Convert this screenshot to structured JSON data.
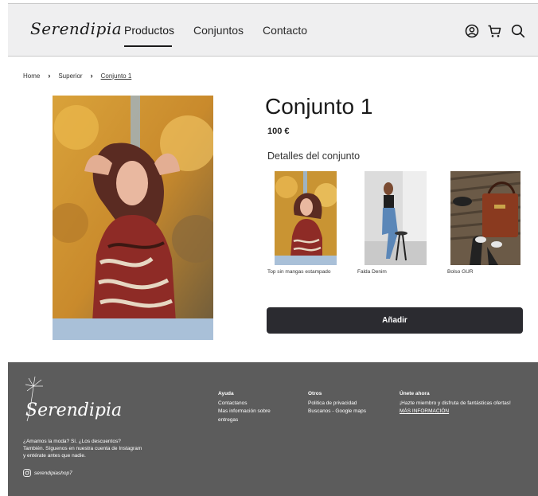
{
  "header": {
    "logo": "Serendipia",
    "nav": [
      "Productos",
      "Conjuntos",
      "Contacto"
    ],
    "icons": [
      "user-icon",
      "cart-icon",
      "search-icon"
    ]
  },
  "breadcrumb": [
    "Home",
    "Superior",
    "Conjunto 1"
  ],
  "product": {
    "title": "Conjunto 1",
    "price": "100 €",
    "details_heading": "Detalles del conjunto",
    "items": [
      "Top sin mangas estampado",
      "Falda Denim",
      "Bolso GUR"
    ],
    "add_button": "Añadir"
  },
  "footer": {
    "logo": "Serendipia",
    "text": "¿Amamos la moda? Sí. ¿Los descuentos? También. Síguenos en nuestra cuenta de Instagram  y entérate antes que nadie.",
    "instagram": "serendipiashop7",
    "col1": {
      "title": "Ayuda",
      "links": [
        "Contactanos",
        "Mas información sobre entregas"
      ]
    },
    "col2": {
      "title": "Otros",
      "links": [
        "Politica de privacidad",
        "Buscanos - Google maps"
      ]
    },
    "col3": {
      "title": "Únete ahora",
      "text": "¡Hazte miembro y disfruta de fantásticas ofertas!",
      "link": "MÁS INFORMACIÓN"
    }
  },
  "colors": {
    "header_bg": "#efeff0",
    "button_bg": "#2b2b30",
    "footer_bg": "#5c5c5c"
  }
}
